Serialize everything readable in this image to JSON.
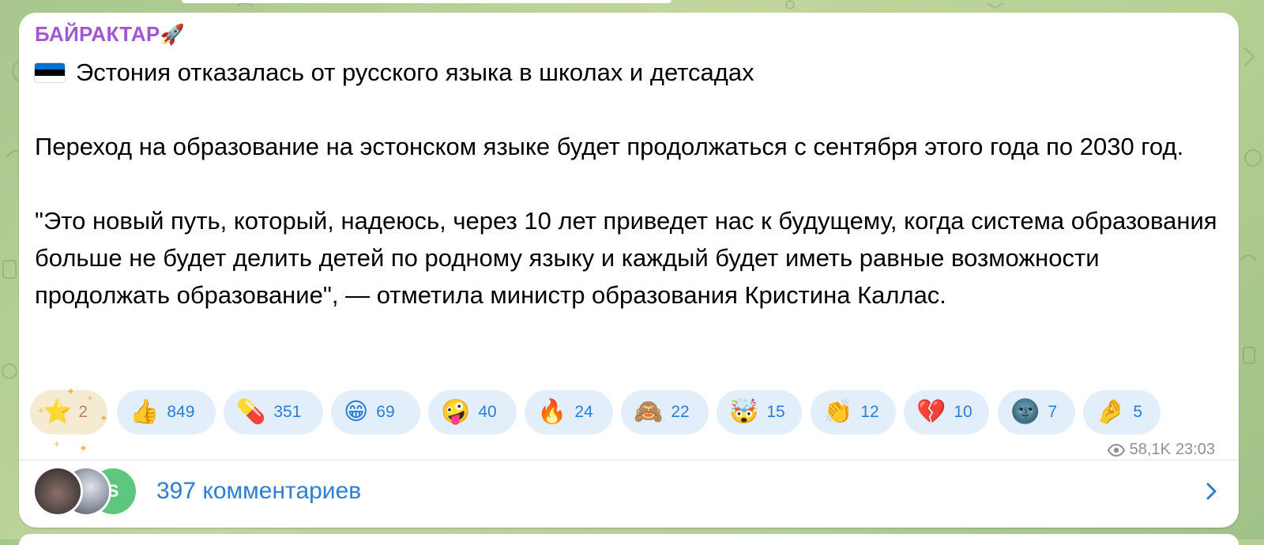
{
  "post": {
    "channel_name": "БАЙРАКТАР",
    "channel_emoji": "🚀",
    "flag_icon": "estonia-flag-icon",
    "flag_colors": [
      "#0072ce",
      "#000000",
      "#ffffff"
    ],
    "text": "Эстония отказалась от русского языка в школах и детсадах\n\nПереход на образование на эстонском языке будет продолжаться с сентября этого года по 2030 год.\n\n\"Это новый путь, который, надеюсь, через 10 лет приведет нас к будущему, когда система образования больше не будет делить детей по родному языку и каждый будет иметь равные возможности продолжать образование\", — отметила министр образования Кристина Каллас."
  },
  "reactions": [
    {
      "emoji": "⭐",
      "count": "2"
    },
    {
      "emoji": "👍",
      "count": "849"
    },
    {
      "emoji": "💊",
      "count": "351"
    },
    {
      "emoji": "😁",
      "count": "69"
    },
    {
      "emoji": "🤪",
      "count": "40"
    },
    {
      "emoji": "🔥",
      "count": "24"
    },
    {
      "emoji": "🙈",
      "count": "22"
    },
    {
      "emoji": "🤯",
      "count": "15"
    },
    {
      "emoji": "👏",
      "count": "12"
    },
    {
      "emoji": "💔",
      "count": "10"
    },
    {
      "emoji": "🌚",
      "count": "7"
    },
    {
      "emoji": "🤌",
      "count": "5"
    }
  ],
  "meta": {
    "views": "58,1K",
    "time": "23:03"
  },
  "comments": {
    "label": "397 комментариев",
    "avatar_letter": "S"
  },
  "colors": {
    "channel_name": "#a256d6",
    "link": "#2b7ed6",
    "reaction_bg": "#e3eefb",
    "meta": "#8d9196"
  }
}
